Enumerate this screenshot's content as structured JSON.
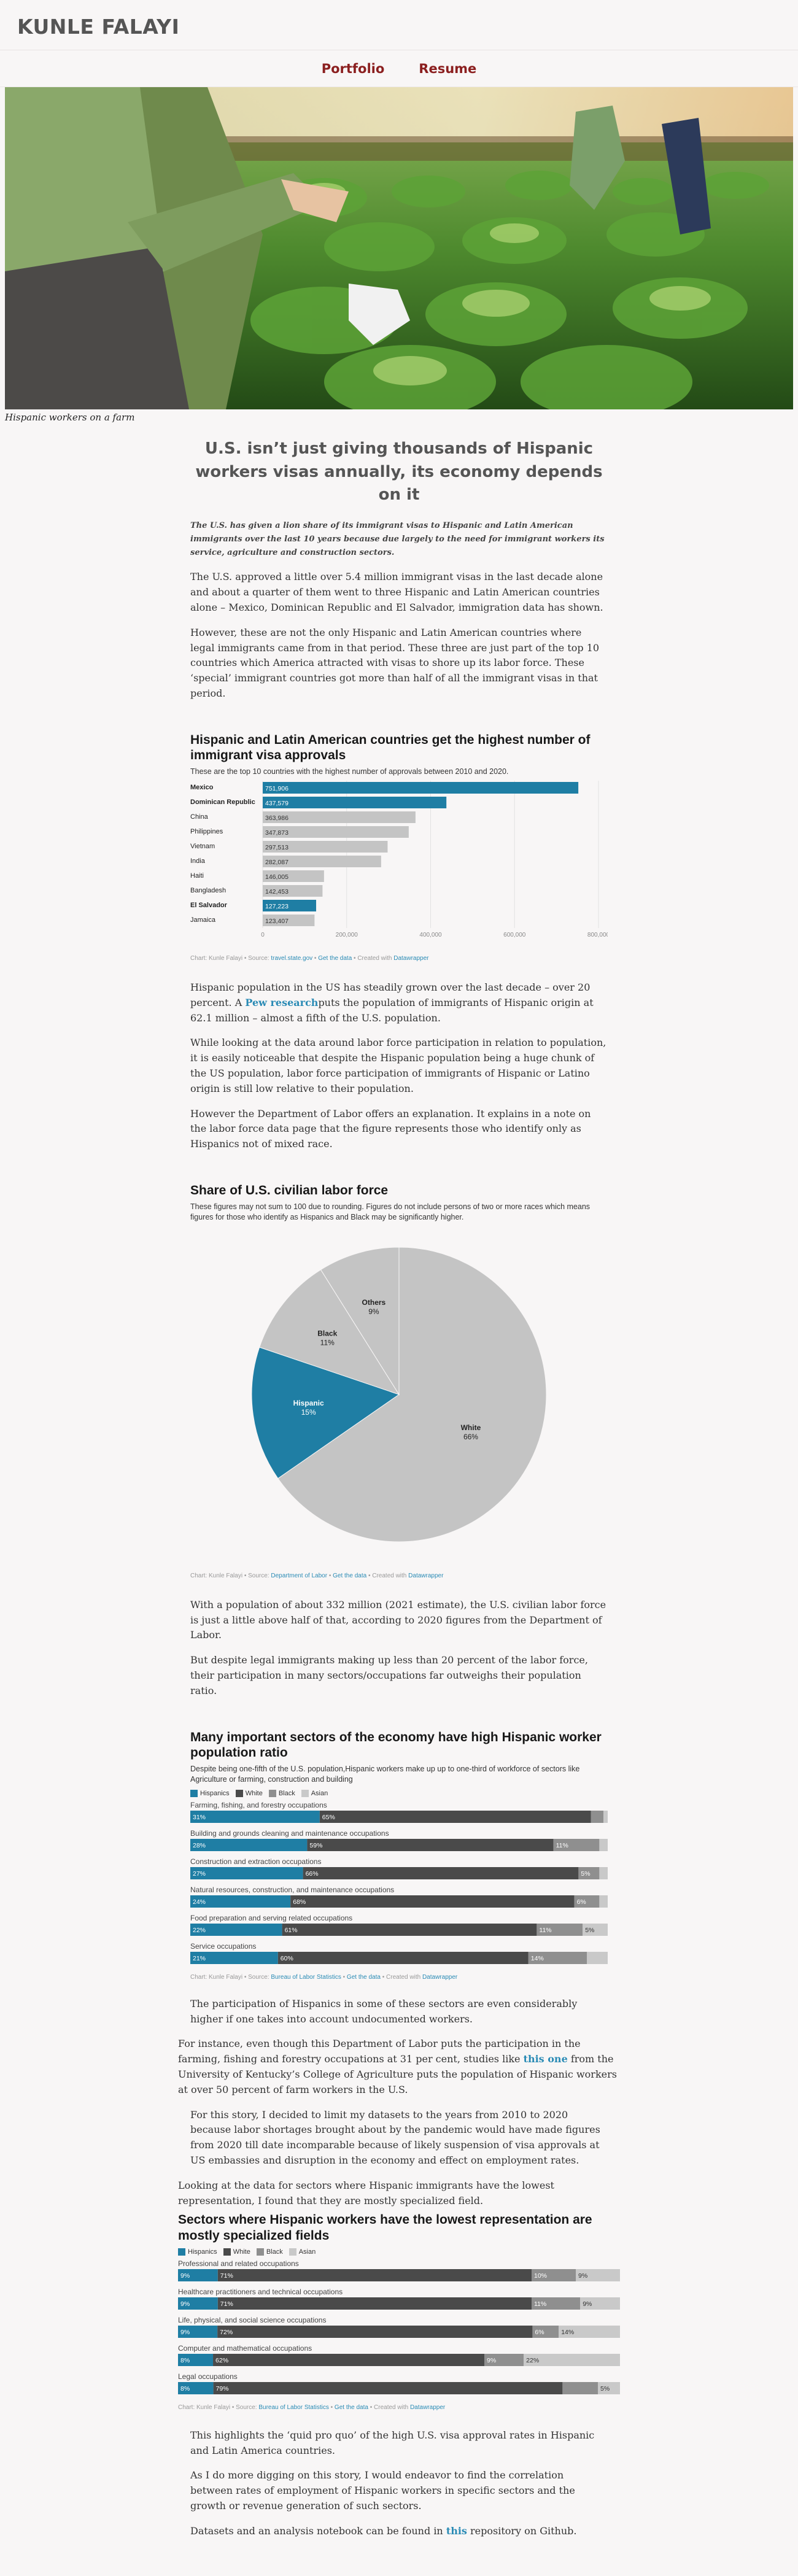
{
  "header": {
    "site_title": "KUNLE FALAYI"
  },
  "nav": {
    "items": [
      {
        "label": "Portfolio"
      },
      {
        "label": "Resume"
      }
    ]
  },
  "hero": {
    "caption": "Hispanic workers on a farm"
  },
  "article": {
    "title": "U.S. isn’t just giving thousands of Hispanic workers visas annually, its economy depends on it",
    "lede": "The U.S. has given a lion share of its immigrant visas to Hispanic and Latin American immigrants over the last 10 years because due largely to the need for immigrant workers its service, agriculture and construction sectors.",
    "p1": "The U.S. approved a little over 5.4 million immigrant visas in the last decade alone and about a quarter of them went to three Hispanic and Latin American countries alone – Mexico, Dominican Republic and El Salvador, immigration data has shown.",
    "p2": "However, these are not the only Hispanic and Latin American countries where legal immigrants came from in that period. These three are just part of the top 10 countries which America attracted with visas to shore up its labor force. These ‘special’ immigrant countries got more than half of all the immigrant visas in that period.",
    "p3_pre": "Hispanic population in the US has steadily grown over the last decade – over 20 percent. A ",
    "p3_link": "Pew research",
    "p3_post": "puts the population of immigrants of Hispanic origin at 62.1 million – almost a fifth of the U.S. population.",
    "p4": "While looking at the data around labor force participation in relation to population, it is easily noticeable that despite the Hispanic population being a huge chunk of the US population, labor force participation of immigrants of Hispanic or Latino origin is still low relative to their population.",
    "p5": "However the Department of Labor offers an explanation. It explains in a note on the labor force data page that the figure represents those who identify only as Hispanics not of mixed race.",
    "p6": "With a population of about 332 million (2021 estimate), the U.S. civilian labor force is just a little above half of that, according to 2020 figures from the Department of Labor.",
    "p7": "But despite legal immigrants making up less than 20 percent of the labor force, their participation in many sectors/occupations far outweighs their population ratio.",
    "p8": "The participation of Hispanics in some of these sectors are even considerably higher if one takes into account undocumented workers.",
    "p9_pre": "For instance, even though this Department of Labor puts the participation in the farming, fishing and forestry occupations at 31 per cent, studies like ",
    "p9_link": "this one",
    "p9_post": " from the University of Kentucky’s College of Agriculture puts the population of Hispanic workers at over 50 percent of farm workers in the U.S.",
    "p10": "For this story, I decided to limit my datasets to the years from 2010 to 2020 because labor shortages brought about by the pandemic would have made figures from 2020 till date incomparable because of likely suspension of visa approvals at US embassies and disruption in the economy and effect on employment rates.",
    "p11": "Looking at the data for sectors where Hispanic immigrants have the lowest representation, I found that they are mostly specialized field.",
    "p12": "This highlights the ‘quid pro quo’ of the high U.S. visa approval rates in Hispanic and Latin America countries.",
    "p13": "As I do more digging on this story, I would endeavor to find the correlation between rates of employment of Hispanic workers in specific sectors and the growth or revenue generation of such sectors.",
    "p14_pre": "Datasets and an analysis notebook can be found in ",
    "p14_link": "this",
    "p14_post": " repository on Github."
  },
  "chart_data": [
    {
      "type": "bar",
      "title": "Hispanic and Latin American countries get the highest number of immigrant visa approvals",
      "subtitle": "These are the top 10 countries with the highest number of approvals between 2010 and 2020.",
      "categories": [
        "Mexico",
        "Dominican Republic",
        "China",
        "Philippines",
        "Vietnam",
        "India",
        "Haiti",
        "Bangladesh",
        "El Salvador",
        "Jamaica"
      ],
      "values": [
        751906,
        437579,
        363986,
        347873,
        297513,
        282087,
        146005,
        142453,
        127223,
        123407
      ],
      "value_labels": [
        "751,906",
        "437,579",
        "363,986",
        "347,873",
        "297,513",
        "282,087",
        "146,005",
        "142,453",
        "127,223",
        "123,407"
      ],
      "highlighted": [
        "Mexico",
        "Dominican Republic",
        "El Salvador"
      ],
      "xlim": [
        0,
        800000
      ],
      "x_ticks": [
        "0",
        "200,000",
        "400,000",
        "600,000",
        "800,000"
      ],
      "colors": {
        "highlight": "#1f7ea4",
        "base": "#c4c4c4"
      },
      "source_pre": "Chart: Kunle Falayi • Source: ",
      "source_link": "travel.state.gov",
      "get_data": "Get the data",
      "created_pre": "Created with ",
      "created_link": "Datawrapper"
    },
    {
      "type": "pie",
      "title": "Share of U.S. civilian labor force",
      "subtitle": "These figures may not sum to 100 due to rounding. Figures do not include persons of two or more races which means figures for those who identify as Hispanics and Black may be significantly higher.",
      "slices": [
        {
          "name": "White",
          "value": 66,
          "label": "66%",
          "color": "#c4c4c4"
        },
        {
          "name": "Hispanic",
          "value": 15,
          "label": "15%",
          "color": "#1f7ea4"
        },
        {
          "name": "Black",
          "value": 11,
          "label": "11%",
          "color": "#c4c4c4"
        },
        {
          "name": "Others",
          "value": 9,
          "label": "9%",
          "color": "#c4c4c4"
        }
      ],
      "source_pre": "Chart: Kunle Falayi • Source: ",
      "source_link": "Department of Labor",
      "get_data": "Get the data",
      "created_pre": "Created with ",
      "created_link": "Datawrapper"
    },
    {
      "type": "bar",
      "stacked": true,
      "title": "Many important sectors of the economy have high Hispanic worker population ratio",
      "subtitle": "Despite being one-fifth of the U.S. population,Hispanic workers make up up to one-third of workforce of sectors like Agriculture or farming, construction and building",
      "legend": [
        "Hispanics",
        "White",
        "Black",
        "Asian"
      ],
      "series_colors": [
        "#1f7ea4",
        "#4a4a4a",
        "#8f8f8f",
        "#c9c9c9"
      ],
      "categories": [
        "Farming, fishing, and forestry occupations",
        "Building and grounds cleaning and maintenance occupations",
        "Construction and extraction occupations",
        "Natural resources, construction, and maintenance occupations",
        "Food preparation and serving related occupations",
        "Service occupations"
      ],
      "series": [
        {
          "name": "Hispanics",
          "values": [
            31,
            28,
            27,
            24,
            22,
            21
          ],
          "labels": [
            "31%",
            "28%",
            "27%",
            "24%",
            "22%",
            "21%"
          ]
        },
        {
          "name": "White",
          "values": [
            65,
            59,
            66,
            68,
            61,
            60
          ],
          "labels": [
            "65%",
            "59%",
            "66%",
            "68%",
            "61%",
            "60%"
          ]
        },
        {
          "name": "Black",
          "values": [
            3,
            11,
            5,
            6,
            11,
            14
          ],
          "labels": [
            "",
            "11%",
            "5%",
            "6%",
            "11%",
            "14%"
          ]
        },
        {
          "name": "Asian",
          "values": [
            1,
            2,
            2,
            2,
            6,
            5
          ],
          "labels": [
            "",
            "",
            "",
            "",
            "5%",
            ""
          ]
        }
      ],
      "source_pre": "Chart: Kunle Falayi • Source: ",
      "source_link": "Bureau of Labor Statistics",
      "get_data": "Get the data",
      "created_pre": "Created with ",
      "created_link": "Datawrapper"
    },
    {
      "type": "bar",
      "stacked": true,
      "title": "Sectors where Hispanic workers have the lowest representation are mostly specialized fields",
      "legend": [
        "Hispanics",
        "White",
        "Black",
        "Asian"
      ],
      "series_colors": [
        "#1f7ea4",
        "#4a4a4a",
        "#8f8f8f",
        "#c9c9c9"
      ],
      "categories": [
        "Professional and related occupations",
        "Healthcare practitioners and technical occupations",
        "Life, physical, and social science occupations",
        "Computer and mathematical occupations",
        "Legal occupations"
      ],
      "series": [
        {
          "name": "Hispanics",
          "values": [
            9,
            9,
            9,
            8,
            8
          ],
          "labels": [
            "9%",
            "9%",
            "9%",
            "8%",
            "8%"
          ]
        },
        {
          "name": "White",
          "values": [
            71,
            71,
            72,
            62,
            79
          ],
          "labels": [
            "71%",
            "71%",
            "72%",
            "62%",
            "79%"
          ]
        },
        {
          "name": "Black",
          "values": [
            10,
            11,
            6,
            9,
            8
          ],
          "labels": [
            "10%",
            "11%",
            "6%",
            "9%",
            ""
          ]
        },
        {
          "name": "Asian",
          "values": [
            10,
            9,
            14,
            22,
            5
          ],
          "labels": [
            "9%",
            "9%",
            "14%",
            "22%",
            "5%"
          ]
        }
      ],
      "source_pre": "Chart: Kunle Falayi • Source: ",
      "source_link": "Bureau of Labor Statistics",
      "get_data": "Get the data",
      "created_pre": "Created with ",
      "created_link": "Datawrapper"
    }
  ]
}
